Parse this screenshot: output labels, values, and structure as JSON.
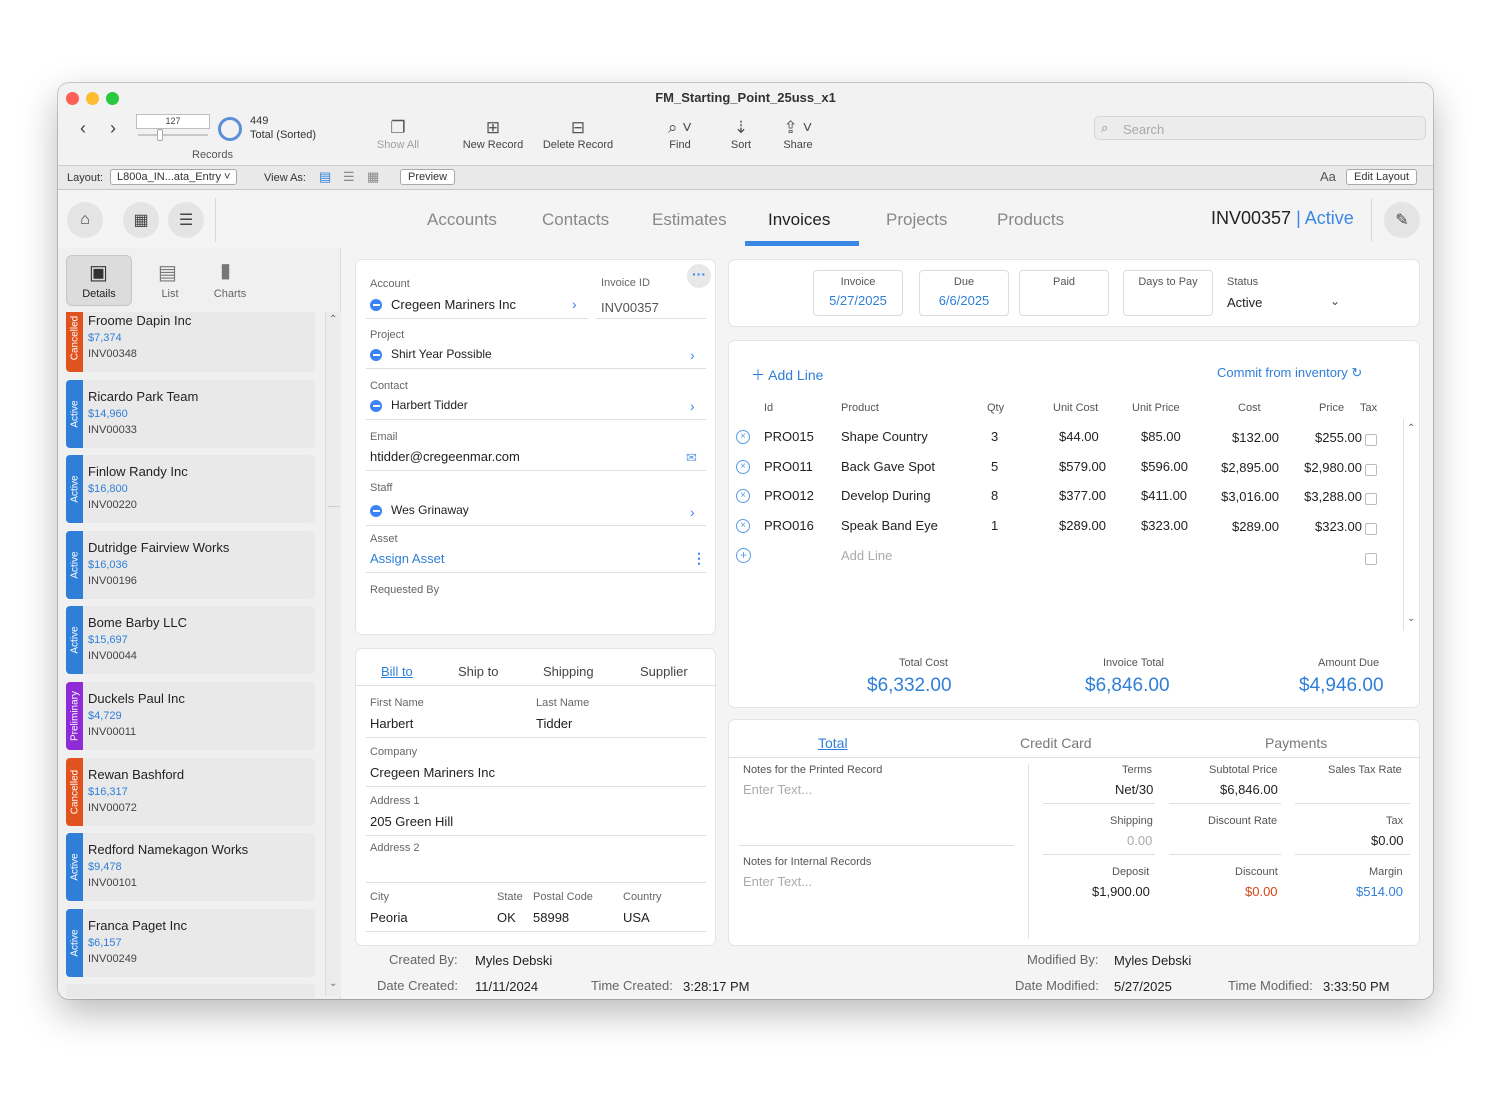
{
  "window": {
    "title": "FM_Starting_Point_25uss_x1"
  },
  "toolbar": {
    "record_number": "127",
    "found_count": "449",
    "found_label": "Total (Sorted)",
    "records_label": "Records",
    "show_all": "Show All",
    "new_record": "New Record",
    "delete_record": "Delete Record",
    "find": "Find",
    "sort": "Sort",
    "share": "Share",
    "search_placeholder": "Search"
  },
  "layoutbar": {
    "layout_label": "Layout:",
    "layout_value": "L800a_IN...ata_Entry",
    "view_as": "View As:",
    "preview": "Preview",
    "edit_layout": "Edit Layout",
    "font_icon": "Aa"
  },
  "nav": {
    "tabs": [
      "Accounts",
      "Contacts",
      "Estimates",
      "Invoices",
      "Projects",
      "Products"
    ],
    "active_tab": "Invoices",
    "record_id": "INV00357",
    "sep": "|",
    "record_status": "Active"
  },
  "sidebar": {
    "tabs": [
      "Details",
      "List",
      "Charts"
    ],
    "items": [
      {
        "status": "Cancelled",
        "color": "#e0531e",
        "name": "Froome Dapin Inc",
        "amount": "$7,374",
        "id": "INV00348"
      },
      {
        "status": "Active",
        "color": "#2f7fd8",
        "name": "Ricardo Park Team",
        "amount": "$14,960",
        "id": "INV00033"
      },
      {
        "status": "Active",
        "color": "#2f7fd8",
        "name": "Finlow Randy Inc",
        "amount": "$16,800",
        "id": "INV00220"
      },
      {
        "status": "Active",
        "color": "#2f7fd8",
        "name": "Dutridge Fairview Works",
        "amount": "$16,036",
        "id": "INV00196"
      },
      {
        "status": "Active",
        "color": "#2f7fd8",
        "name": "Bome Barby LLC",
        "amount": "$15,697",
        "id": "INV00044"
      },
      {
        "status": "Preliminary",
        "color": "#8e2bd6",
        "name": "Duckels Paul Inc",
        "amount": "$4,729",
        "id": "INV00011"
      },
      {
        "status": "Cancelled",
        "color": "#e0531e",
        "name": "Rewan Bashford",
        "amount": "$16,317",
        "id": "INV00072"
      },
      {
        "status": "Active",
        "color": "#2f7fd8",
        "name": "Redford Namekagon Works",
        "amount": "$9,478",
        "id": "INV00101"
      },
      {
        "status": "Active",
        "color": "#2f7fd8",
        "name": "Franca Paget Inc",
        "amount": "$6,157",
        "id": "INV00249"
      }
    ]
  },
  "details": {
    "account_label": "Account",
    "account": "Cregeen Mariners Inc",
    "invoice_id_label": "Invoice ID",
    "invoice_id": "INV00357",
    "project_label": "Project",
    "project": "Shirt Year Possible",
    "contact_label": "Contact",
    "contact": "Harbert Tidder",
    "email_label": "Email",
    "email": "htidder@cregeenmar.com",
    "staff_label": "Staff",
    "staff": "Wes Grinaway",
    "asset_label": "Asset",
    "asset": "Assign Asset",
    "requested_by_label": "Requested By"
  },
  "address": {
    "tabs": [
      "Bill to",
      "Ship to",
      "Shipping",
      "Supplier"
    ],
    "first_name_label": "First Name",
    "first_name": "Harbert",
    "last_name_label": "Last Name",
    "last_name": "Tidder",
    "company_label": "Company",
    "company": "Cregeen Mariners Inc",
    "address1_label": "Address 1",
    "address1": "205 Green Hill",
    "address2_label": "Address 2",
    "city_label": "City",
    "city": "Peoria",
    "state_label": "State",
    "state": "OK",
    "postal_label": "Postal Code",
    "postal": "58998",
    "country_label": "Country",
    "country": "USA"
  },
  "dates": {
    "invoice_label": "Invoice",
    "invoice": "5/27/2025",
    "due_label": "Due",
    "due": "6/6/2025",
    "paid_label": "Paid",
    "days_label": "Days to Pay",
    "status_label": "Status",
    "status": "Active"
  },
  "lines": {
    "add_line": "Add Line",
    "commit": "Commit from inventory",
    "headers": [
      "Id",
      "Product",
      "Qty",
      "Unit Cost",
      "Unit Price",
      "Cost",
      "Price",
      "Tax"
    ],
    "rows": [
      {
        "id": "PRO015",
        "product": "Shape Country",
        "qty": "3",
        "unit_cost": "$44.00",
        "unit_price": "$85.00",
        "cost": "$132.00",
        "price": "$255.00"
      },
      {
        "id": "PRO011",
        "product": "Back Gave Spot",
        "qty": "5",
        "unit_cost": "$579.00",
        "unit_price": "$596.00",
        "cost": "$2,895.00",
        "price": "$2,980.00"
      },
      {
        "id": "PRO012",
        "product": "Develop During",
        "qty": "8",
        "unit_cost": "$377.00",
        "unit_price": "$411.00",
        "cost": "$3,016.00",
        "price": "$3,288.00"
      },
      {
        "id": "PRO016",
        "product": "Speak Band Eye",
        "qty": "1",
        "unit_cost": "$289.00",
        "unit_price": "$323.00",
        "cost": "$289.00",
        "price": "$323.00"
      }
    ],
    "add_line_placeholder": "Add Line",
    "total_cost_label": "Total Cost",
    "total_cost": "$6,332.00",
    "invoice_total_label": "Invoice Total",
    "invoice_total": "$6,846.00",
    "amount_due_label": "Amount Due",
    "amount_due": "$4,946.00"
  },
  "totals": {
    "tabs": [
      "Total",
      "Credit Card",
      "Payments"
    ],
    "notes_printed_label": "Notes for the Printed Record",
    "notes_placeholder": "Enter Text...",
    "notes_internal_label": "Notes for Internal Records",
    "terms_label": "Terms",
    "terms": "Net/30",
    "subtotal_label": "Subtotal Price",
    "subtotal": "$6,846.00",
    "sales_tax_rate_label": "Sales Tax Rate",
    "shipping_label": "Shipping",
    "shipping": "0.00",
    "discount_rate_label": "Discount Rate",
    "tax_label": "Tax",
    "tax": "$0.00",
    "deposit_label": "Deposit",
    "deposit": "$1,900.00",
    "discount_label": "Discount",
    "discount": "$0.00",
    "margin_label": "Margin",
    "margin": "$514.00"
  },
  "footer": {
    "created_by_label": "Created By:",
    "created_by": "Myles Debski",
    "date_created_label": "Date Created:",
    "date_created": "11/11/2024",
    "time_created_label": "Time Created:",
    "time_created": "3:28:17 PM",
    "modified_by_label": "Modified By:",
    "modified_by": "Myles Debski",
    "date_modified_label": "Date Modified:",
    "date_modified": "5/27/2025",
    "time_modified_label": "Time Modified:",
    "time_modified": "3:33:50 PM"
  }
}
